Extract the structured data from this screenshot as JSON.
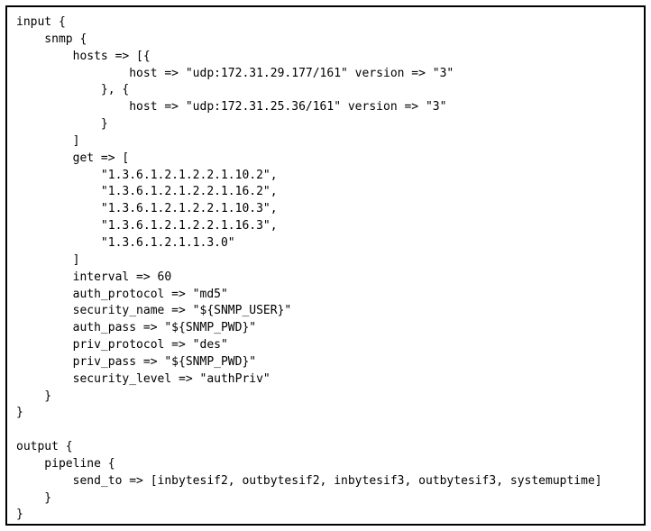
{
  "code": {
    "lines": [
      "input {",
      "    snmp {",
      "        hosts => [{",
      "                host => \"udp:172.31.29.177/161\" version => \"3\"",
      "            }, {",
      "                host => \"udp:172.31.25.36/161\" version => \"3\"",
      "            }",
      "        ]",
      "        get => [",
      "            \"1.3.6.1.2.1.2.2.1.10.2\",",
      "            \"1.3.6.1.2.1.2.2.1.16.2\",",
      "            \"1.3.6.1.2.1.2.2.1.10.3\",",
      "            \"1.3.6.1.2.1.2.2.1.16.3\",",
      "            \"1.3.6.1.2.1.1.3.0\"",
      "        ]",
      "        interval => 60",
      "        auth_protocol => \"md5\"",
      "        security_name => \"${SNMP_USER}\"",
      "        auth_pass => \"${SNMP_PWD}\"",
      "        priv_protocol => \"des\"",
      "        priv_pass => \"${SNMP_PWD}\"",
      "        security_level => \"authPriv\"",
      "    }",
      "}",
      "",
      "output {",
      "    pipeline {",
      "        send_to => [inbytesif2, outbytesif2, inbytesif3, outbytesif3, systemuptime]",
      "    }",
      "}"
    ]
  }
}
